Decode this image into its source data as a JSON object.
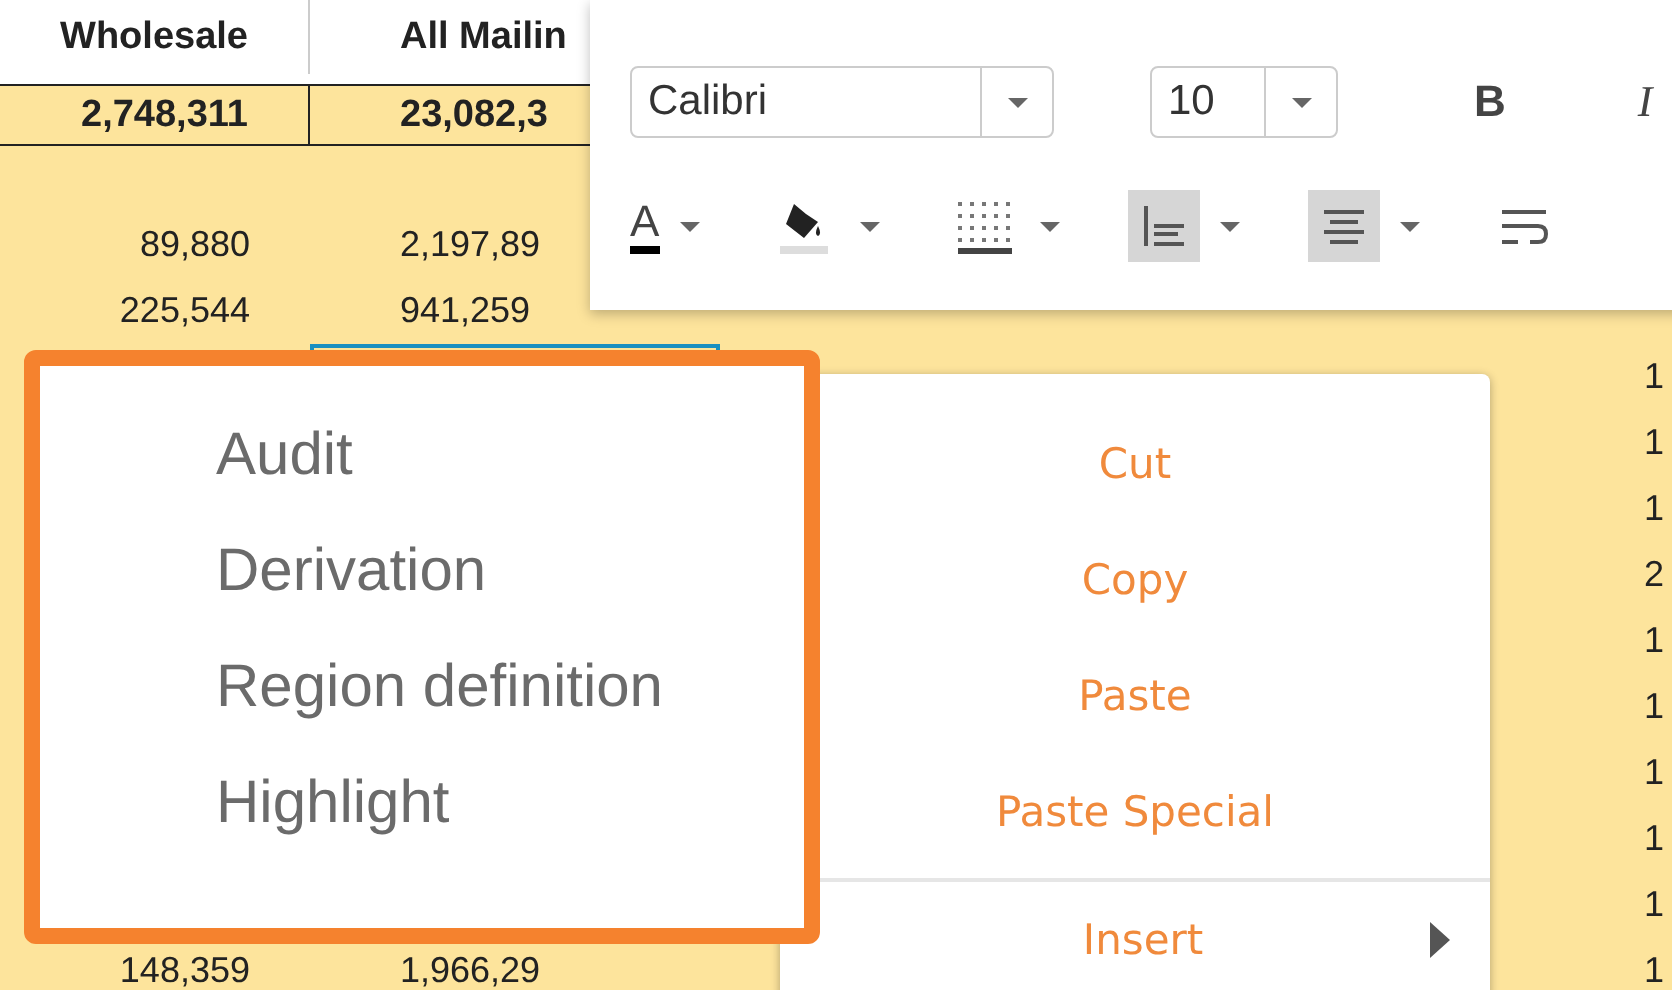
{
  "sheet": {
    "columns": [
      "Wholesale",
      "All Mailin"
    ],
    "total_row": [
      "2,748,311",
      "23,082,3"
    ],
    "rows": [
      {
        "column_1": "89,880",
        "column_2": "2,197,89",
        "selected": false
      },
      {
        "column_1": "225,544",
        "column_2": "941,259",
        "selected": false
      },
      {
        "column_5": "1",
        "selected": true
      },
      {
        "column_5": "1"
      },
      {
        "column_5": "1"
      },
      {
        "column_5": "2"
      },
      {
        "column_5": "1"
      },
      {
        "column_5": "1"
      },
      {
        "column_5": "1"
      },
      {
        "column_5": "1"
      },
      {
        "column_5": "1"
      },
      {
        "column_1": "148,359",
        "column_2": "1,966,29",
        "column_5": "1",
        "selected": false
      }
    ]
  },
  "toolbar": {
    "font": "Calibri",
    "size": "10",
    "top_buttons": [
      {
        "kind": "bold",
        "label": "B",
        "selected": false
      },
      {
        "kind": "italic",
        "label": "I",
        "selected": false
      }
    ],
    "bottom_buttons": [
      {
        "kind": "font_color",
        "label": "A",
        "selected": false
      },
      {
        "kind": "fill",
        "selected": false
      },
      {
        "kind": "borders",
        "selected": false
      },
      {
        "kind": "valign",
        "selected": true
      },
      {
        "kind": "halign",
        "selected": true
      },
      {
        "kind": "wrap",
        "selected": false
      }
    ]
  },
  "side_menu": {
    "items": [
      "Audit",
      "Derivation",
      "Region definition",
      "Highlight"
    ]
  },
  "context_menu": {
    "items": [
      {
        "label": "Cut",
        "kind": "action"
      },
      {
        "label": "Copy",
        "kind": "action"
      },
      {
        "label": "Paste",
        "kind": "action"
      },
      {
        "label": "Paste Special",
        "kind": "action"
      },
      {
        "kind": "separator"
      },
      {
        "label": "Insert",
        "kind": "submenu"
      }
    ]
  }
}
